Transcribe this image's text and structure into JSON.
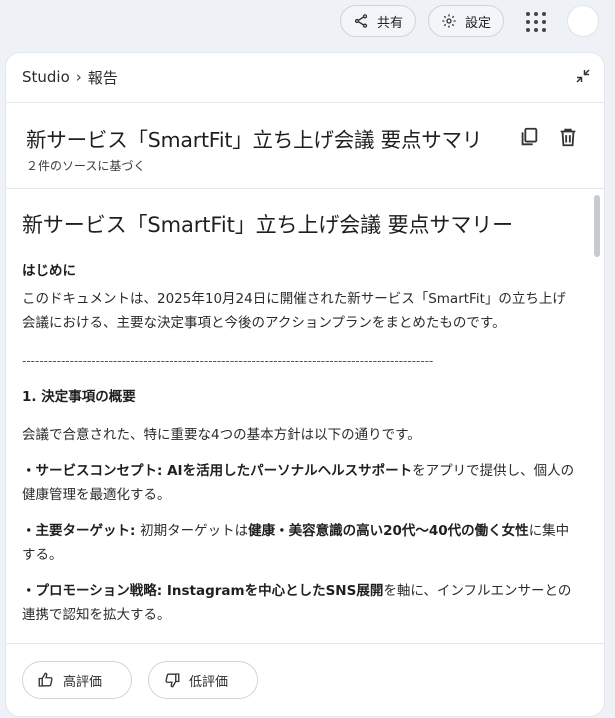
{
  "topbar": {
    "share_label": "共有",
    "settings_label": "設定"
  },
  "breadcrumb": {
    "root": "Studio",
    "current": "報告"
  },
  "doc": {
    "title": "新サービス「SmartFit」立ち上げ会議 要点サマリ",
    "sources": "２件のソースに基づく"
  },
  "content": {
    "heading": "新サービス「SmartFit」立ち上げ会議 要点サマリー",
    "intro_heading": "はじめに",
    "intro_text": "このドキュメントは、2025年10月24日に開催された新サービス「SmartFit」の立ち上げ会議における、主要な決定事項と今後のアクションプランをまとめたものです。",
    "rule": "-----------------------------------------------------------------------------------------------",
    "section1_heading": "1. 決定事項の概要",
    "section1_lead": "会議で合意された、特に重要な4つの基本方針は以下の通りです。",
    "bullets": [
      {
        "lead": "・サービスコンセプト: ",
        "bold": "AIを活用したパーソナルヘルスサポート",
        "rest": "をアプリで提供し、個人の健康管理を最適化する。"
      },
      {
        "lead": "・主要ターゲット: ",
        "pre": "初期ターゲットは",
        "bold": "健康・美容意識の高い20代〜40代の働く女性",
        "rest": "に集中する。"
      },
      {
        "lead": "・プロモーション戦略: ",
        "bold": "Instagramを中心としたSNS展開",
        "rest": "を軸に、インフルエンサーとの連携で認知を拡大する。"
      }
    ]
  },
  "feedback": {
    "good_label": "高評価",
    "bad_label": "低評価"
  }
}
